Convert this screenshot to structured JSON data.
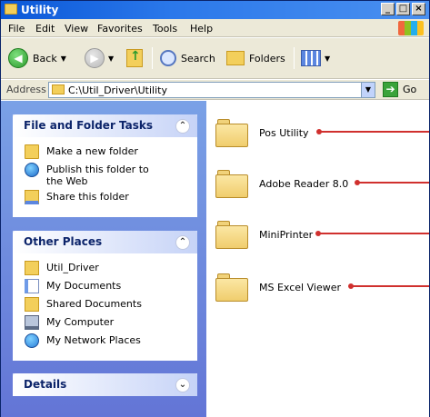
{
  "window": {
    "title": "Utility"
  },
  "controls": {
    "minimize": "_",
    "maximize": "□",
    "close": "×"
  },
  "menu": {
    "items": [
      "File",
      "Edit",
      "View",
      "Favorites",
      "Tools",
      "Help"
    ]
  },
  "toolbar": {
    "back_label": "Back",
    "search_label": "Search",
    "folders_label": "Folders"
  },
  "address": {
    "label": "Address",
    "value": "C:\\Util_Driver\\Utility",
    "go_label": "Go"
  },
  "panels": {
    "tasks": {
      "title": "File and Folder Tasks",
      "items": [
        "Make a new folder",
        "Publish this folder to the Web",
        "Share this folder"
      ]
    },
    "places": {
      "title": "Other Places",
      "items": [
        "Util_Driver",
        "My Documents",
        "Shared Documents",
        "My Computer",
        "My Network Places"
      ]
    },
    "details": {
      "title": "Details"
    }
  },
  "folders": [
    {
      "name": "Pos Utility"
    },
    {
      "name": "Adobe Reader 8.0"
    },
    {
      "name": "MiniPrinter"
    },
    {
      "name": "MS Excel Viewer"
    }
  ],
  "colors": {
    "callout": "#d0302e",
    "titlebar": "#0a58d8",
    "panel_title": "#0c246a"
  },
  "icons": [
    "folder-icon",
    "back-arrow-icon",
    "forward-arrow-icon",
    "up-folder-icon",
    "search-icon",
    "folders-icon",
    "views-icon",
    "go-arrow-icon",
    "globe-icon",
    "computer-icon",
    "network-icon"
  ]
}
